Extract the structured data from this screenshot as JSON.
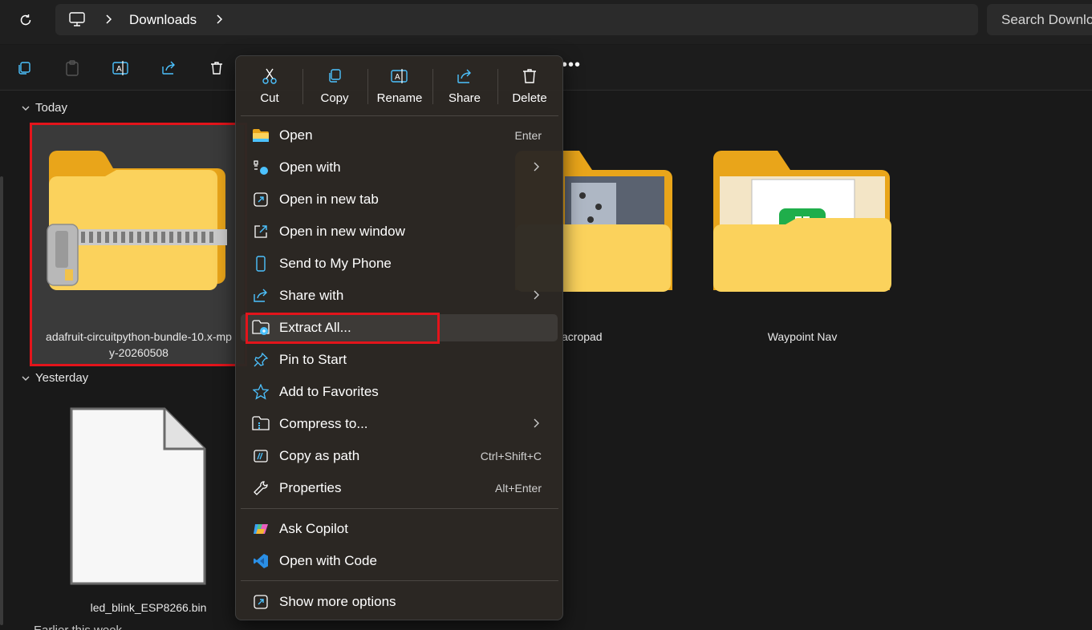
{
  "address_bar": {
    "crumb": "Downloads"
  },
  "search": {
    "placeholder": "Search Downloads"
  },
  "groups": {
    "today": "Today",
    "yesterday": "Yesterday",
    "earlier": "Earlier this week"
  },
  "files": {
    "zip_name": "adafruit-circuitpython-bundle-10.x-mpy-20260508",
    "zip_name_line1": "adafruit-circuitpython-bundle-10.x-mp",
    "zip_name_line2": "y-20260508",
    "macropad_name": "acropad",
    "waypoint_name": "Waypoint Nav",
    "bin_name": "led_blink_ESP8266.bin"
  },
  "context_menu": {
    "quick_actions": [
      "Cut",
      "Copy",
      "Rename",
      "Share",
      "Delete"
    ],
    "items": [
      {
        "label": "Open",
        "shortcut": "Enter",
        "icon": "folder-icon"
      },
      {
        "label": "Open with",
        "submenu": true,
        "icon": "open-with-icon"
      },
      {
        "label": "Open in new tab",
        "icon": "new-tab-icon"
      },
      {
        "label": "Open in new window",
        "icon": "new-window-icon"
      },
      {
        "label": "Send to My Phone",
        "icon": "phone-icon"
      },
      {
        "label": "Share with",
        "submenu": true,
        "icon": "share-icon"
      },
      {
        "label": "Extract All...",
        "icon": "extract-icon",
        "highlighted": true
      },
      {
        "label": "Pin to Start",
        "icon": "pin-icon"
      },
      {
        "label": "Add to Favorites",
        "icon": "star-icon"
      },
      {
        "label": "Compress to...",
        "submenu": true,
        "icon": "compress-icon"
      },
      {
        "label": "Copy as path",
        "shortcut": "Ctrl+Shift+C",
        "icon": "copy-path-icon"
      },
      {
        "label": "Properties",
        "shortcut": "Alt+Enter",
        "icon": "wrench-icon"
      },
      {
        "label": "Ask Copilot",
        "icon": "copilot-icon"
      },
      {
        "label": "Open with Code",
        "icon": "vscode-icon"
      },
      {
        "label": "Show more options",
        "icon": "more-options-icon"
      }
    ]
  },
  "colors": {
    "highlight_red": "#e3141b",
    "accent_blue": "#4cc2ff",
    "folder_yellow": "#f8c533"
  }
}
